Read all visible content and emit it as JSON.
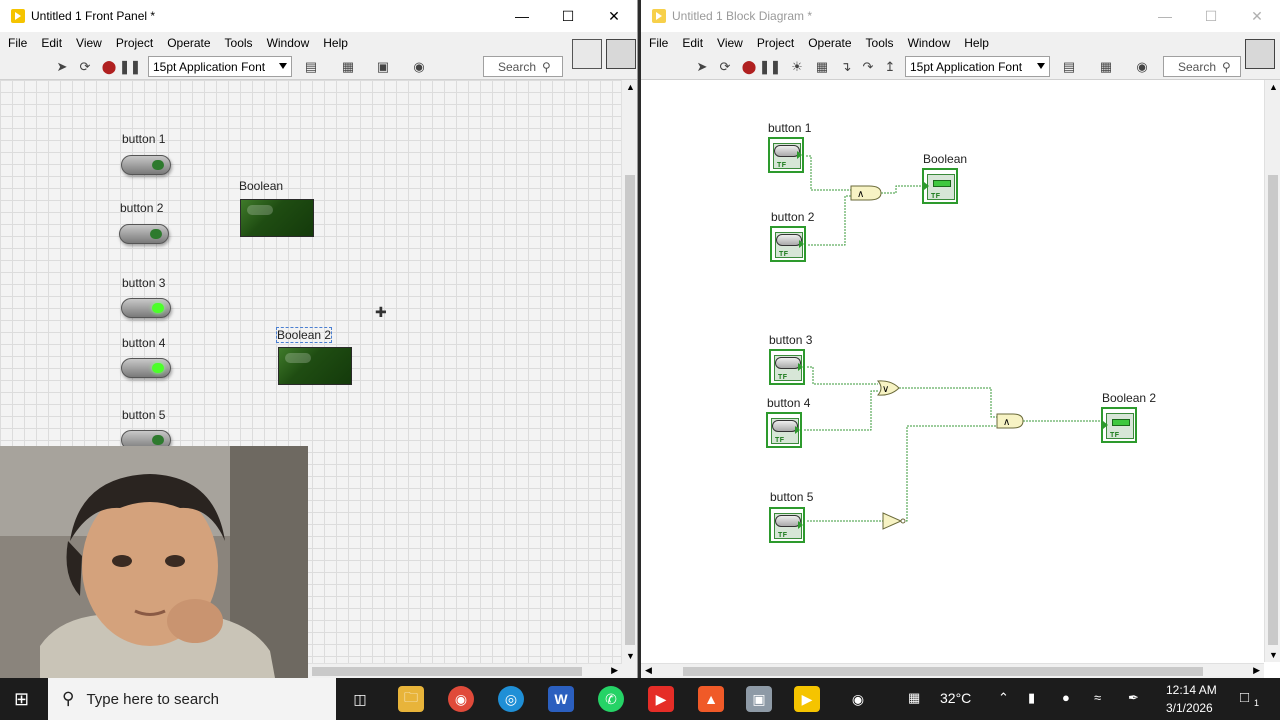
{
  "front_panel": {
    "title": "Untitled 1 Front Panel *",
    "menu": [
      "File",
      "Edit",
      "View",
      "Project",
      "Operate",
      "Tools",
      "Window",
      "Help"
    ],
    "font": "15pt Application Font",
    "search_placeholder": "Search",
    "controls": [
      {
        "label": "button 1",
        "state": "off"
      },
      {
        "label": "button 2",
        "state": "off"
      },
      {
        "label": "button 3",
        "state": "on"
      },
      {
        "label": "button 4",
        "state": "on"
      },
      {
        "label": "button 5",
        "state": "off"
      }
    ],
    "indicators": [
      {
        "label": "Boolean"
      },
      {
        "label": "Boolean 2"
      }
    ]
  },
  "block_diagram": {
    "title": "Untitled 1 Block Diagram *",
    "menu": [
      "File",
      "Edit",
      "View",
      "Project",
      "Operate",
      "Tools",
      "Window",
      "Help"
    ],
    "font": "15pt Application Font",
    "search_placeholder": "Search",
    "terminals": [
      "button 1",
      "button 2",
      "button 3",
      "button 4",
      "button 5"
    ],
    "indicators": [
      "Boolean",
      "Boolean 2"
    ],
    "terminal_text": "TF",
    "gates": [
      "AND",
      "OR",
      "AND",
      "NOT"
    ]
  },
  "taskbar": {
    "search_placeholder": "Type here to search",
    "temperature": "32°C",
    "time": "12:14 AM",
    "date": "3/1/2026",
    "notification_count": "1"
  },
  "colors": {
    "wire_green": "#3a9a3a",
    "led_on": "#4cff2a",
    "indicator_dark_green": "#1f4d12"
  }
}
